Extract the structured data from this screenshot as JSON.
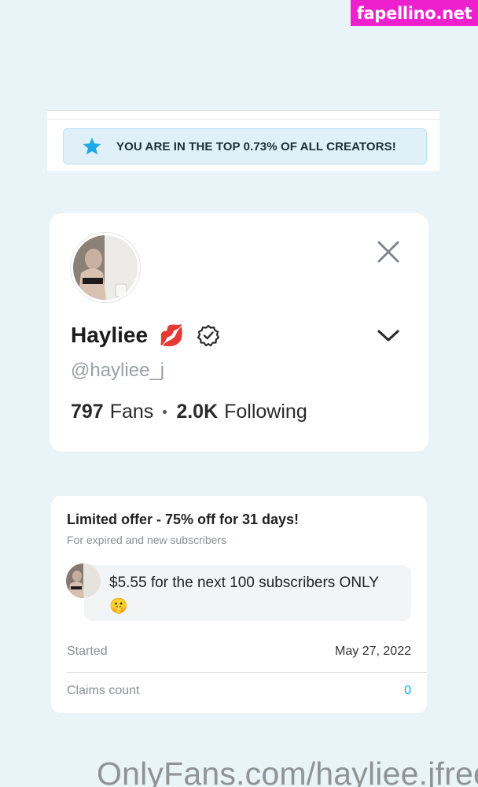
{
  "watermark_top": "fapellino.net",
  "banner": {
    "text": "YOU ARE IN THE TOP 0.73% OF ALL CREATORS!",
    "icon": "star-icon"
  },
  "profile": {
    "name": "Hayliee",
    "name_emoji": "💋",
    "handle": "@hayliee_j",
    "fans_count": "797",
    "fans_label": "Fans",
    "following_count": "2.0K",
    "following_label": "Following",
    "icons": [
      "close-icon",
      "verified-icon",
      "chevron-down-icon"
    ]
  },
  "offer": {
    "title": "Limited offer - 75% off for 31 days!",
    "subtitle": "For expired and new subscribers",
    "message": "$5.55 for the next 100 subscribers ONLY 🤫",
    "started_label": "Started",
    "started_value": "May 27, 2022",
    "claims_label": "Claims count",
    "claims_value": "0"
  },
  "watermark_bottom": "OnlyFans.com/hayliee.jfree",
  "colors": {
    "accent": "#00aff0",
    "background": "#e8f4f7",
    "watermark": "#ee1fcd"
  }
}
